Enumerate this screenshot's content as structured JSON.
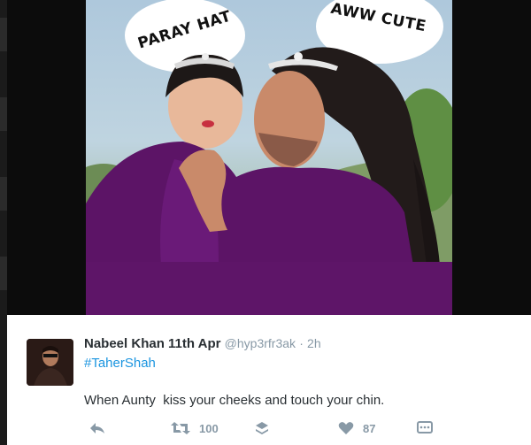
{
  "image": {
    "bubble_left_text": "PARAY HAT",
    "bubble_right_text": "AWW CUTE"
  },
  "tweet": {
    "author_name": "Nabeel Khan 11th Apr",
    "handle": "@hyp3rfr3ak",
    "separator": "·",
    "timestamp": "2h",
    "hashtag": "#TaherShah",
    "text": "When Aunty  kiss your cheeks and touch your chin.",
    "retweet_count": "100",
    "like_count": "87"
  },
  "icons": [
    "reply-icon",
    "retweet-icon",
    "layers-icon",
    "heart-icon",
    "more-icon"
  ],
  "colors": {
    "link": "#1b95e0",
    "muted": "#8899a6",
    "text": "#292f33",
    "purple": "#5c1466"
  }
}
